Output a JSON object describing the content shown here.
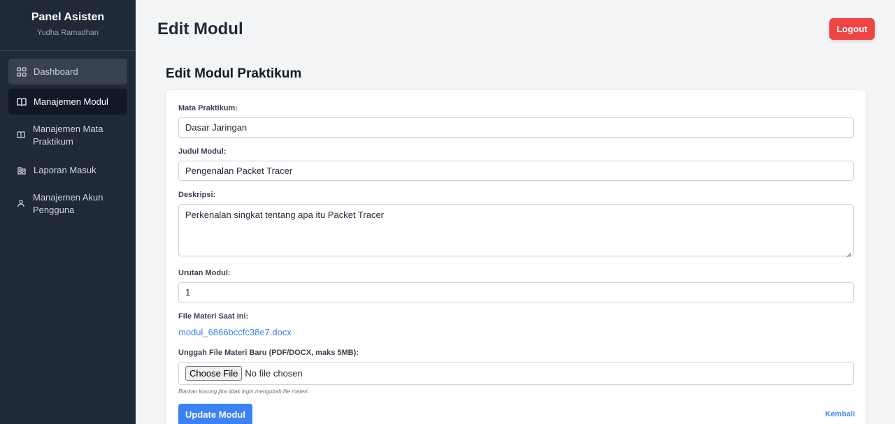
{
  "sidebar": {
    "title": "Panel Asisten",
    "user": "Yudha Ramadhan",
    "items": [
      {
        "label": "Dashboard",
        "icon": "grid-icon"
      },
      {
        "label": "Manajemen Modul",
        "icon": "book-icon"
      },
      {
        "label": "Manajemen Mata Praktikum",
        "icon": "book-icon"
      },
      {
        "label": "Laporan Masuk",
        "icon": "report-icon"
      },
      {
        "label": "Manajemen Akun Pengguna",
        "icon": "user-icon"
      }
    ]
  },
  "header": {
    "title": "Edit Modul",
    "logout_label": "Logout"
  },
  "form": {
    "title": "Edit Modul Praktikum",
    "mata_praktikum": {
      "label": "Mata Praktikum:",
      "value": "Dasar Jaringan"
    },
    "judul": {
      "label": "Judul Modul:",
      "value": "Pengenalan Packet Tracer"
    },
    "deskripsi": {
      "label": "Deskripsi:",
      "value": "Perkenalan singkat tentang apa itu Packet Tracer"
    },
    "urutan": {
      "label": "Urutan Modul:",
      "value": "1"
    },
    "current_file": {
      "label": "File Materi Saat Ini:",
      "name": "modul_6866bccfc38e7.docx"
    },
    "upload": {
      "label": "Unggah File Materi Baru (PDF/DOCX, maks 5MB):",
      "button": "Choose File",
      "status": "No file chosen",
      "hint": "Biarkan kosong jika tidak ingin mengubah file materi."
    },
    "submit_label": "Update Modul",
    "back_label": "Kembali"
  },
  "colors": {
    "sidebar_bg": "#1f2937",
    "primary": "#3b82f6",
    "danger": "#ef4444",
    "page_bg": "#f3f4f6"
  }
}
